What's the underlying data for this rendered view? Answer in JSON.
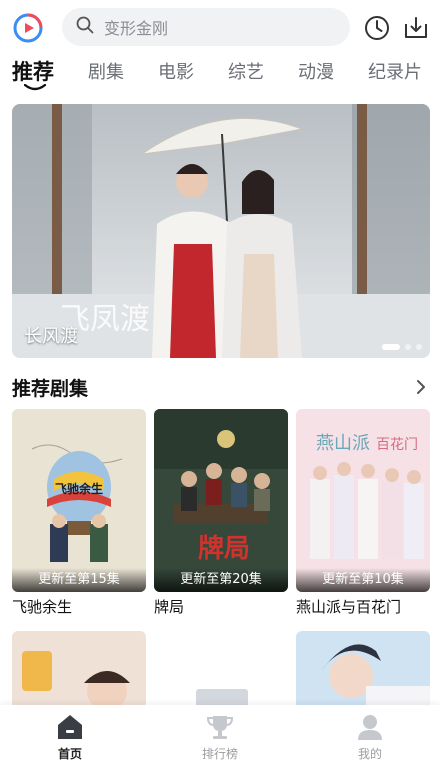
{
  "search": {
    "placeholder": "变形金刚"
  },
  "tabs": [
    {
      "label": "推荐",
      "active": true
    },
    {
      "label": "剧集"
    },
    {
      "label": "电影"
    },
    {
      "label": "综艺"
    },
    {
      "label": "动漫"
    },
    {
      "label": "纪录片"
    }
  ],
  "banner": {
    "title": "长风渡",
    "dot_count": 3,
    "active_dot": 0
  },
  "section": {
    "title": "推荐剧集"
  },
  "cards": [
    {
      "title": "飞驰余生",
      "badge": "更新至第15集"
    },
    {
      "title": "牌局",
      "badge": "更新至第20集"
    },
    {
      "title": "燕山派与百花门",
      "badge": "更新至第10集"
    }
  ],
  "bottom_nav": [
    {
      "label": "首页",
      "icon": "home-icon",
      "active": true
    },
    {
      "label": "排行榜",
      "icon": "trophy-icon"
    },
    {
      "label": "我的",
      "icon": "person-icon"
    }
  ],
  "colors": {
    "accent": "#2b6ff3",
    "logo_red": "#f04b5a",
    "logo_blue": "#3b8cf5"
  }
}
